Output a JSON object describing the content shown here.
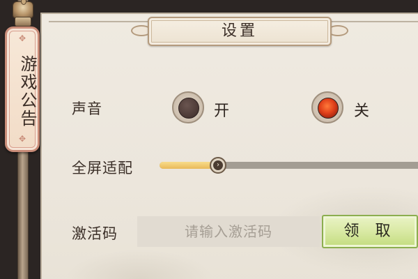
{
  "sidebar": {
    "announcement_label": "游戏公告"
  },
  "header": {
    "title": "设置"
  },
  "settings": {
    "sound": {
      "label": "声音",
      "on_label": "开",
      "off_label": "关",
      "selected": "off"
    },
    "fullscreen": {
      "label": "全屏适配",
      "level": 0.22
    },
    "activation": {
      "label": "激活码",
      "placeholder": "请输入激活码",
      "value": "",
      "claim_label": "领 取"
    }
  },
  "colors": {
    "accent_on": "#e0401a",
    "slider_fill": "#e9b95a",
    "claim_button": "#d9e9a4",
    "panel": "#ece6dc"
  },
  "icons": {
    "knob": "chevron-right-icon",
    "pole_cap": "ornament-icon"
  }
}
